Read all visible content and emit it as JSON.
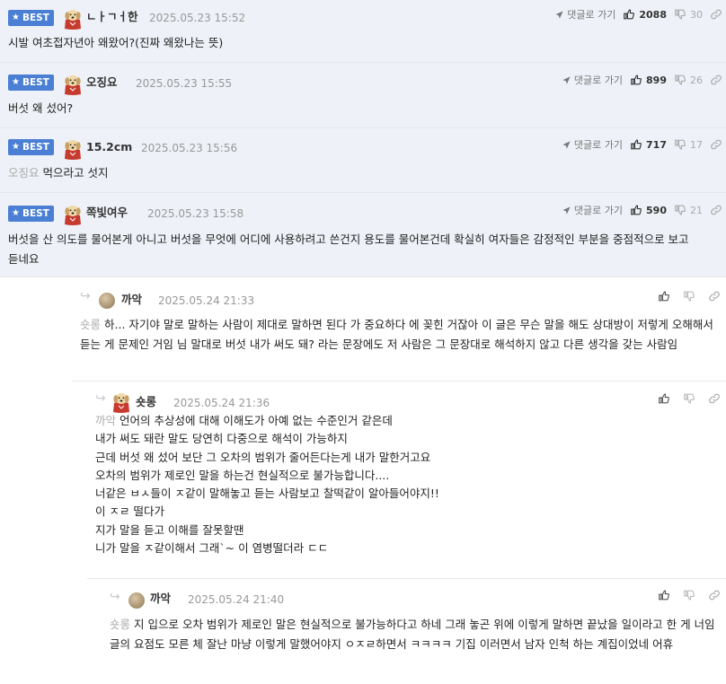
{
  "best_label": "BEST",
  "reply_link_label": "댓글로 가기",
  "comments": [
    {
      "nickname": "ㄴㅏㄱㅓ한",
      "date": "2025.05.23 15:52",
      "upvotes": "2088",
      "downvotes": "30",
      "text": "시발 여초접자년아 왜왔어?(진짜 왜왔나는 뜻)"
    },
    {
      "nickname": "오징요",
      "date": "2025.05.23 15:55",
      "upvotes": "899",
      "downvotes": "26",
      "text": "버섯 왜 섰어?"
    },
    {
      "nickname": "15.2cm",
      "date": "2025.05.23 15:56",
      "upvotes": "717",
      "downvotes": "17",
      "mention": "오징요",
      "text": "먹으라고 섯지"
    },
    {
      "nickname": "쪽빛여우",
      "date": "2025.05.23 15:58",
      "upvotes": "590",
      "downvotes": "21",
      "text": "버섯을 산 의도를 물어본게 아니고 버섯을 무엇에 어디에 사용하려고 쓴건지 용도를 물어본건데 확실히 여자들은 감정적인 부분을 중점적으로 보고 듣네요"
    }
  ],
  "replies": [
    {
      "nickname": "까악",
      "date": "2025.05.24 21:33",
      "mention": "숏롱",
      "text": "하... 자기야 말로 말하는 사람이 제대로 말하면 된다 가 중요하다 에 꽂힌 거잖아 이 글은 무슨 말을 해도 상대방이 저렇게 오해해서 듣는 게 문제인 거임 님 말대로 버섯 내가 써도 돼? 라는 문장에도 저 사람은 그 문장대로 해석하지 않고 다른 생각을 갖는 사람임"
    },
    {
      "nickname": "숏롱",
      "date": "2025.05.24 21:36",
      "mention": "까악",
      "lines": [
        "언어의 추상성에 대해 이해도가 아예 없는 수준인거 같은데",
        "내가 써도 돼란 말도 당연히 다중으로 해석이 가능하지",
        "근데 버섯 왜 섰어 보단 그 오차의 범위가 줄어든다는게 내가 말한거고요",
        "오차의 범위가 제로인 말을 하는건 현실적으로 불가능합니다....",
        "너같은 ㅂㅅ들이 ㅈ같이 말해놓고 듣는 사람보고 찰떡같이 알아들어야지!!",
        "이 ㅈㄹ 떨다가",
        "지가 말을 듣고 이해를 잘못할땐",
        "니가 말을 ㅈ같이해서 그래`~ 이 염병떨더라 ㄷㄷ"
      ]
    },
    {
      "nickname": "까악",
      "date": "2025.05.24 21:40",
      "mention": "숏롱",
      "text": "지 입으로 오차 범위가 제로인 말은 현실적으로 불가능하다고 하네 그래 놓곤 위에 이렇게 말하면 끝났을 일이라고 한 게 너임 글의 요점도 모른 체 잘난 마냥 이렇게 말했어야지 ㅇㅈㄹ하면서 ㅋㅋㅋㅋ 기집 이러면서 남자 인척 하는 계집이었네 어휴"
    }
  ],
  "icons": {
    "reply_link": "paper-plane-icon",
    "upvote": "thumbs-up-icon",
    "downvote": "thumbs-down-icon",
    "share": "link-icon",
    "reply_indicator": "reply-arrow-icon",
    "avatar_dog": "dog-avatar-icon",
    "avatar_ball": "beige-ball-avatar-icon"
  },
  "colors": {
    "best_background": "#eef1f7",
    "best_badge": "#4a7fd4",
    "mention": "#aaaaaa",
    "date": "#999999"
  }
}
